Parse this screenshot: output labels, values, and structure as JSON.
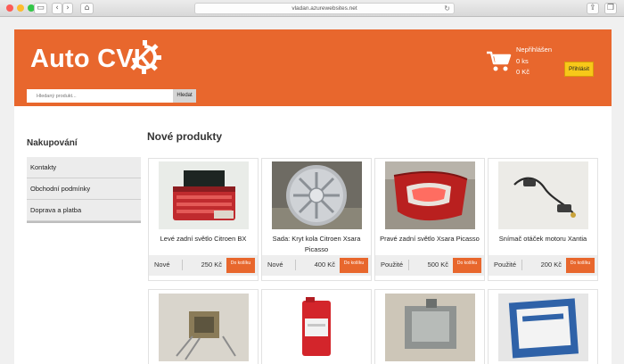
{
  "browser": {
    "url": "vladan.azurewebsites.net"
  },
  "header": {
    "logo": "Auto CVK",
    "search_placeholder": "Hledaný produkt...",
    "search_button": "Hledat",
    "user_status": "Nepřihlášen",
    "cart_count": "0 ks",
    "cart_price": "0 Kč",
    "login_button": "Přihlásit"
  },
  "sidebar": {
    "title": "Nakupování",
    "items": [
      "Kontakty",
      "Obchodní podmínky",
      "Doprava a platba"
    ]
  },
  "main": {
    "title": "Nové produkty",
    "buy_label": "Do košíku",
    "products": [
      {
        "name": "Levé zadní světlo Citroen BX",
        "condition": "Nové",
        "price": "250 Kč"
      },
      {
        "name": "Sada: Kryt kola Citroen Xsara Picasso",
        "condition": "Nové",
        "price": "400 Kč"
      },
      {
        "name": "Pravé zadní světlo Xsara Picasso",
        "condition": "Použité",
        "price": "500 Kč"
      },
      {
        "name": "Snímač otáček motoru Xantia",
        "condition": "Použité",
        "price": "200 Kč"
      }
    ]
  },
  "colors": {
    "accent": "#e8672d",
    "login": "#f7c819"
  }
}
